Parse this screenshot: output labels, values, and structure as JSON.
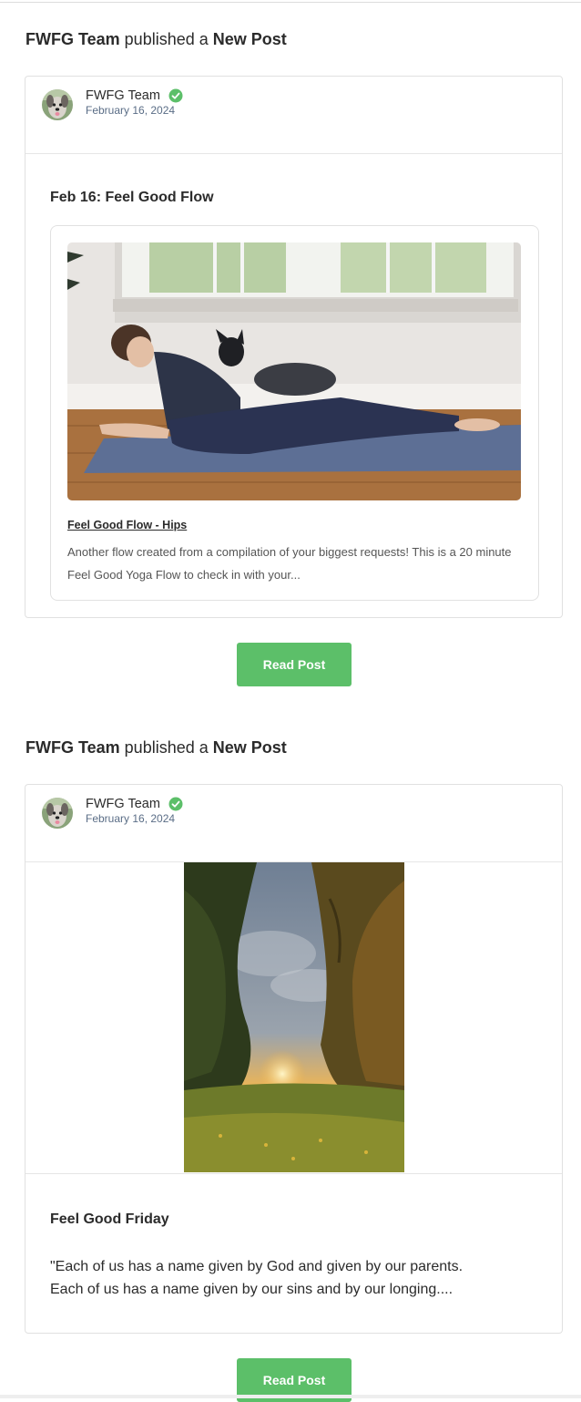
{
  "posts": [
    {
      "heading": {
        "author": "FWFG Team",
        "verb": " published a ",
        "type": "New Post"
      },
      "author_name": "FWFG Team",
      "date": "February 16, 2024",
      "title": "Feb 16: Feel Good Flow",
      "embed": {
        "link_text": "Feel Good Flow - Hips",
        "description": "Another flow created from a compilation of your biggest requests! This is a 20 minute Feel Good Yoga Flow to check in with your..."
      },
      "button_label": "Read Post"
    },
    {
      "heading": {
        "author": "FWFG Team",
        "verb": " published a ",
        "type": "New Post"
      },
      "author_name": "FWFG Team",
      "date": "February 16, 2024",
      "title": "Feel Good Friday",
      "excerpt_lines": [
        "\"Each of us has a name given by God and given by our parents.",
        "Each of us has a name given by our sins and by our longing...."
      ],
      "button_label": "Read Post"
    }
  ],
  "colors": {
    "button": "#5cbf69",
    "verified": "#5cbf69",
    "date": "#5a6d86"
  },
  "icons": {
    "verified": "verified-check-icon",
    "avatar": "dog-avatar"
  }
}
